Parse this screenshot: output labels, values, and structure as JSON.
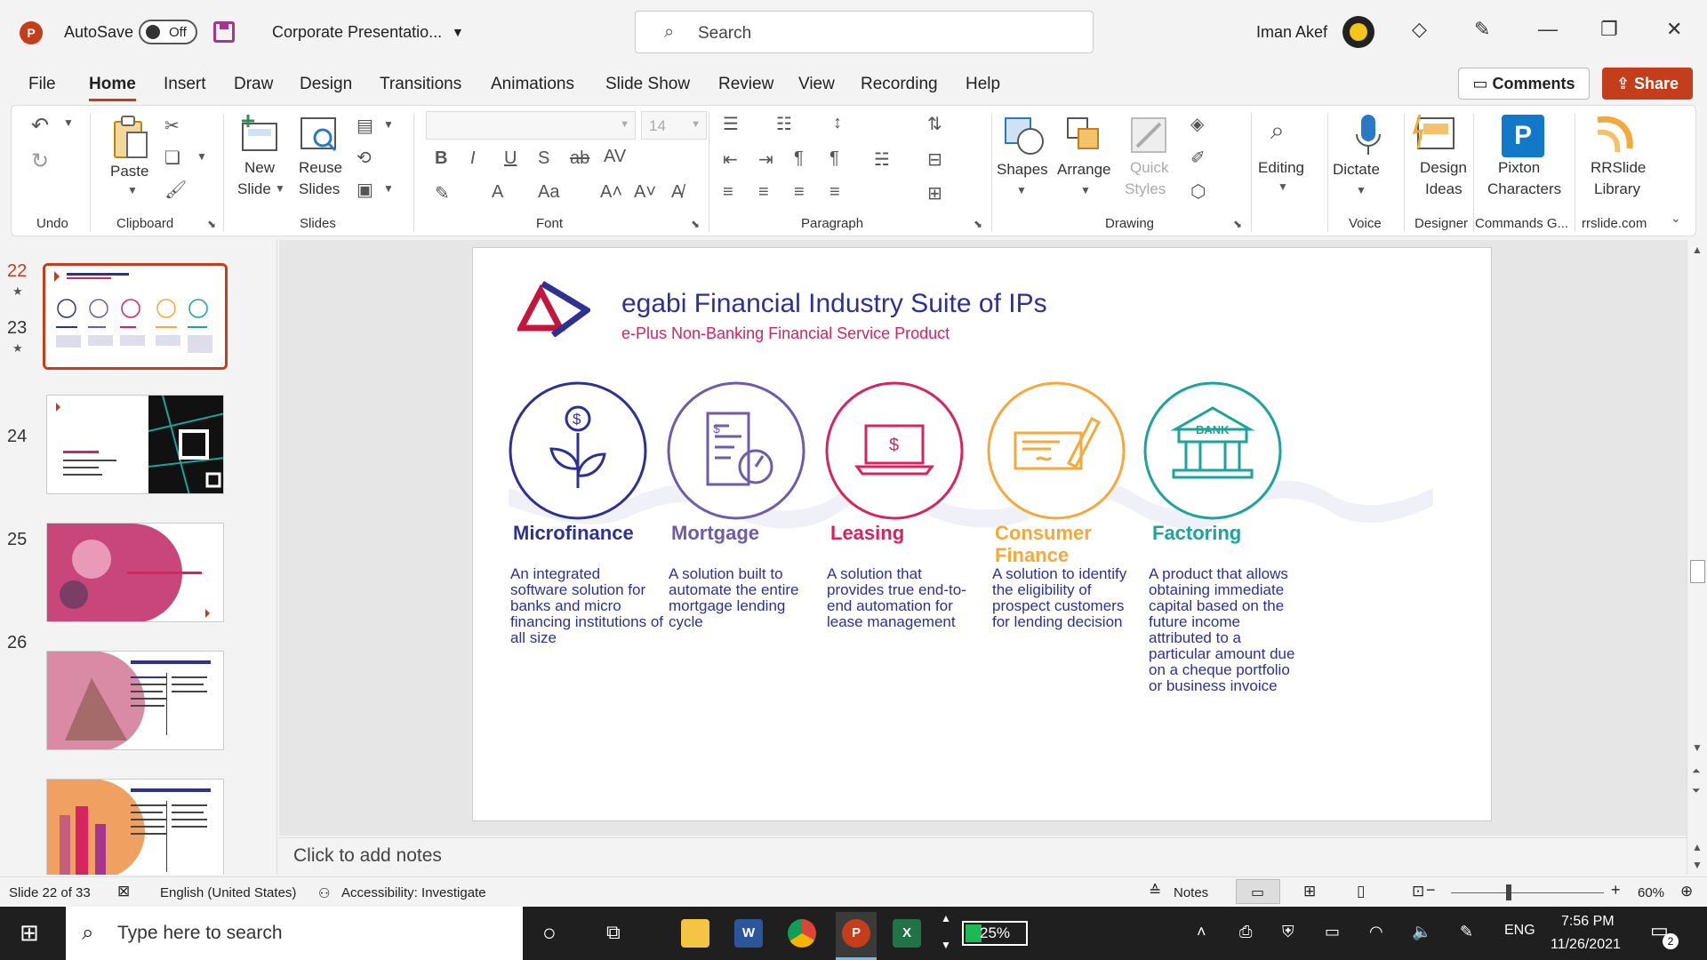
{
  "titlebar": {
    "app_logo": "P",
    "autosave_label": "AutoSave",
    "autosave_state": "Off",
    "doc_title": "Corporate Presentatio...",
    "search_placeholder": "Search",
    "user_name": "Iman Akef"
  },
  "menu": {
    "tabs": [
      "File",
      "Home",
      "Insert",
      "Draw",
      "Design",
      "Transitions",
      "Animations",
      "Slide Show",
      "Review",
      "View",
      "Recording",
      "Help"
    ],
    "active": "Home",
    "comments_label": "Comments",
    "share_label": "Share"
  },
  "ribbon": {
    "groups": {
      "undo": "Undo",
      "clipboard": "Clipboard",
      "slides": "Slides",
      "font": "Font",
      "paragraph": "Paragraph",
      "drawing": "Drawing",
      "voice": "Voice",
      "designer": "Designer",
      "commands": "Commands G...",
      "rrslide": "rrslide.com"
    },
    "buttons": {
      "paste": "Paste",
      "new_slide_1": "New",
      "new_slide_2": "Slide",
      "reuse_1": "Reuse",
      "reuse_2": "Slides",
      "font_size": "14",
      "shapes": "Shapes",
      "arrange": "Arrange",
      "quick_styles_1": "Quick",
      "quick_styles_2": "Styles",
      "editing": "Editing",
      "dictate": "Dictate",
      "design_ideas_1": "Design",
      "design_ideas_2": "Ideas",
      "pixton_1": "Pixton",
      "pixton_2": "Characters",
      "rrslide_1": "RRSlide",
      "rrslide_2": "Library"
    }
  },
  "slide_pane": {
    "thumbnails": [
      {
        "num": "22",
        "star": true,
        "selected": true
      },
      {
        "num": "23",
        "star": true,
        "selected": false
      },
      {
        "num": "24",
        "star": false,
        "selected": false
      },
      {
        "num": "25",
        "star": false,
        "selected": false
      },
      {
        "num": "26",
        "star": false,
        "selected": false
      }
    ]
  },
  "slide": {
    "title": "egabi Financial Industry Suite of IPs",
    "subtitle": "e-Plus Non-Banking Financial Service Product",
    "products": [
      {
        "name": "Microfinance",
        "color": "#2e3192",
        "icon": "plant-dollar-icon",
        "desc_lines": [
          "An integrated",
          "software solution for",
          "banks and micro",
          "financing institutions of",
          "all size"
        ]
      },
      {
        "name": "Mortgage",
        "color": "#6f5ba7",
        "icon": "document-gauge-icon",
        "desc_lines": [
          "A solution built to",
          "automate the entire",
          "mortgage lending",
          "cycle"
        ]
      },
      {
        "name": "Leasing",
        "color": "#d6245f",
        "icon": "laptop-dollar-icon",
        "desc_lines": [
          "A solution that",
          "provides true end-to-",
          "end automation for",
          "lease management"
        ]
      },
      {
        "name": "Consumer Finance",
        "color": "#f4a93b",
        "icon": "cheque-pen-icon",
        "desc_lines": [
          "A solution to identify",
          "the eligibility of",
          "prospect customers",
          "for lending decision"
        ]
      },
      {
        "name": "Factoring",
        "color": "#1ba39c",
        "icon": "bank-icon",
        "desc_lines": [
          "A product that allows",
          "obtaining immediate",
          "capital based on the",
          "future income",
          "attributed to a",
          "particular amount due",
          "on a cheque portfolio",
          "or business invoice"
        ]
      }
    ],
    "bank_text": "BANK"
  },
  "notes_placeholder": "Click to add notes",
  "status": {
    "slide_info": "Slide 22 of 33",
    "language": "English (United States)",
    "accessibility": "Accessibility: Investigate",
    "notes_label": "Notes",
    "zoom": "60%"
  },
  "taskbar": {
    "search_placeholder": "Type here to search",
    "battery": "25%",
    "lang": "ENG",
    "time": "7:56 PM",
    "date": "11/26/2021",
    "notifications": "2"
  }
}
